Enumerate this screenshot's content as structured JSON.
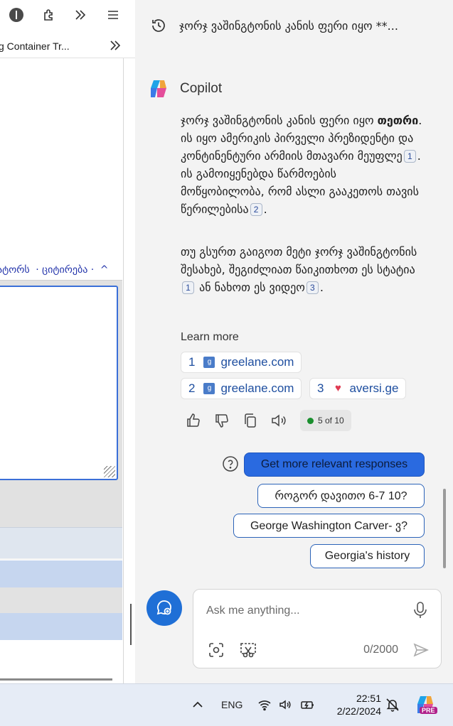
{
  "browser": {
    "bookmark_text": "g Container Tr...",
    "wiki_links": [
      "ატორს",
      "· ციტირება ·",
      "^"
    ]
  },
  "panel": {
    "history_title": "ჯორჯ ვაშინგტონის კანის ფერი იყო **...",
    "assistant_name": "Copilot",
    "para1": {
      "t1": "ჯორჯ ვაშინგტონის კანის ფერი იყო ",
      "bold": "თეთრი",
      "t2": ". ის იყო ამერიკის პირველი პრეზიდენტი და კონტინენტური არმიის მთავარი მეუფლე",
      "c1": "1",
      "t3": ". ის გამოიყენებდა წარმოების მოწყობილობა, რომ ასლი გააკეთოს თავის წერილებისა",
      "c2": "2",
      "t4": "."
    },
    "para2": {
      "t1": "თუ გსურთ გაიგოთ მეტი ჯორჯ ვაშინგტონის შესახებ, შეგიძლიათ წაიკითხოთ ეს სტატია",
      "c1": "1",
      "t2": " ან ნახოთ ეს ვიდეო",
      "c2": "3",
      "t3": "."
    },
    "learn_more_label": "Learn more",
    "sources": [
      {
        "num": "1",
        "label": "greelane.com"
      },
      {
        "num": "2",
        "label": "greelane.com"
      },
      {
        "num": "3",
        "label": "aversi.ge"
      }
    ],
    "response_counter": "5 of 10",
    "suggestions": {
      "primary": "Get more relevant responses",
      "s1": "როგორ დავითო 6-7 10?",
      "s2": "George Washington Carver- ვ?",
      "s3": "Georgia's history"
    },
    "composer": {
      "placeholder": "Ask me anything...",
      "char_count": "0/2000"
    }
  },
  "taskbar": {
    "language": "ENG",
    "time": "22:51",
    "date": "2/22/2024",
    "copilot_badge": "PRE"
  },
  "colors": {
    "accent_blue": "#2a6ae0",
    "counter_dot": "#1a8f2e"
  }
}
